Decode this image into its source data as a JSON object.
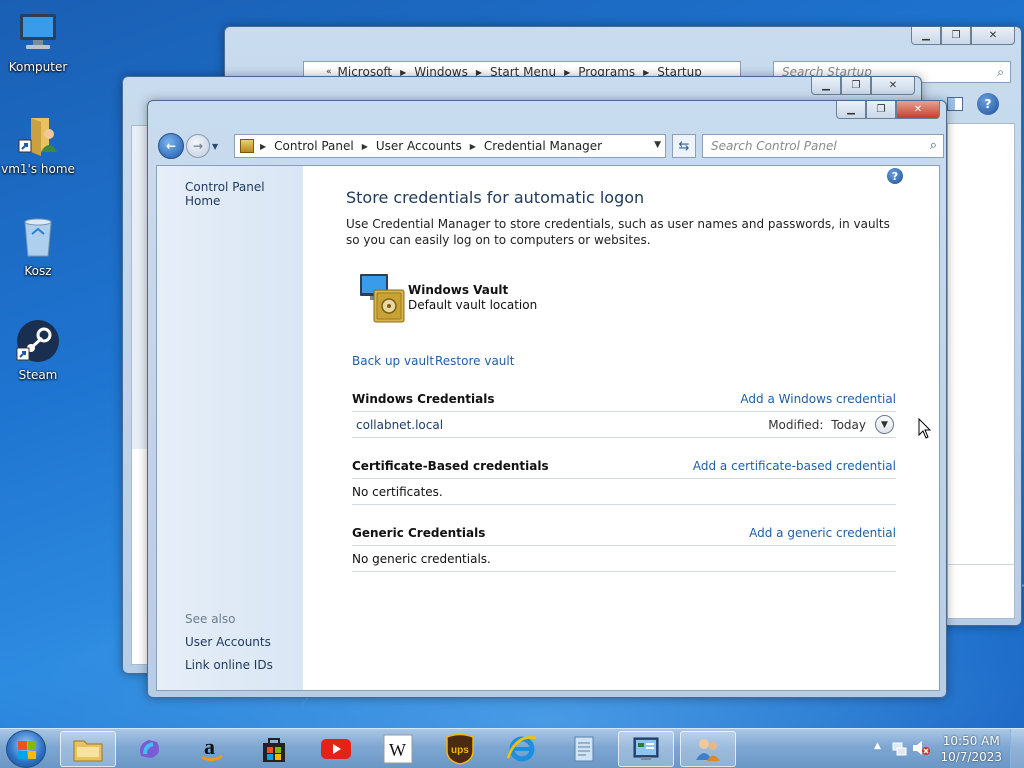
{
  "desktop": {
    "icons": [
      {
        "label": "Komputer"
      },
      {
        "label": "vm1's home"
      },
      {
        "label": "Kosz"
      },
      {
        "label": "Steam"
      }
    ]
  },
  "back_window_1": {
    "breadcrumb": [
      "Microsoft",
      "Windows",
      "Start Menu",
      "Programs",
      "Startup"
    ],
    "search_placeholder": "Search Startup"
  },
  "main_window": {
    "address": {
      "crumbs": [
        "Control Panel",
        "User Accounts",
        "Credential Manager"
      ]
    },
    "search_placeholder": "Search Control Panel",
    "left_pane": {
      "home_link": "Control Panel Home",
      "see_also": "See also",
      "links": [
        "User Accounts",
        "Link online IDs"
      ]
    },
    "content": {
      "title": "Store credentials for automatic logon",
      "description": "Use Credential Manager to store credentials, such as user names and passwords, in vaults so you can easily log on to computers or websites.",
      "vault_name": "Windows Vault",
      "vault_location": "Default vault location",
      "back_up": "Back up vault",
      "restore": "Restore vault",
      "windows_credentials": {
        "label": "Windows Credentials",
        "add": "Add a Windows credential",
        "entry": "collabnet.local",
        "modified_label": "Modified:",
        "modified_value": "Today"
      },
      "certificate_credentials": {
        "label": "Certificate-Based credentials",
        "add": "Add a certificate-based credential",
        "empty": "No certificates."
      },
      "generic_credentials": {
        "label": "Generic Credentials",
        "add": "Add a generic credential",
        "empty": "No generic credentials."
      }
    }
  },
  "taskbar": {
    "time": "10:50 AM",
    "date": "10/7/2023"
  }
}
